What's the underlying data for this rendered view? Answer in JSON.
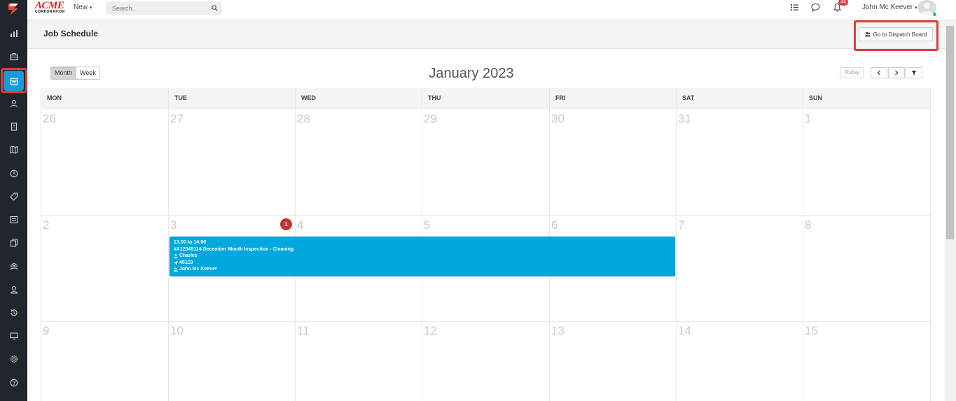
{
  "brand": {
    "name": "ACME",
    "tagline": "CORPORATION"
  },
  "topbar": {
    "new_label": "New",
    "search_placeholder": "Search..",
    "notification_count": "31",
    "user_name": "John Mc Keever"
  },
  "sidebar": {
    "items": [
      {
        "icon": "reports-icon"
      },
      {
        "icon": "briefcase-icon"
      },
      {
        "icon": "calendar-icon",
        "active": true
      },
      {
        "icon": "users-icon"
      },
      {
        "icon": "building-icon"
      },
      {
        "icon": "map-icon"
      },
      {
        "icon": "clock-icon"
      },
      {
        "icon": "tag-icon"
      },
      {
        "icon": "list-icon"
      },
      {
        "icon": "documents-icon"
      },
      {
        "icon": "team-icon"
      },
      {
        "icon": "person-icon"
      },
      {
        "icon": "history-icon"
      },
      {
        "icon": "monitor-icon"
      },
      {
        "icon": "settings-icon"
      },
      {
        "icon": "help-icon"
      }
    ]
  },
  "page": {
    "title": "Job Schedule",
    "dispatch_button": "Go to Dispatch Board"
  },
  "calendar": {
    "view_month": "Month",
    "view_week": "Week",
    "title": "January 2023",
    "today_label": "Today",
    "weekdays": [
      "MON",
      "TUE",
      "WED",
      "THU",
      "FRI",
      "SAT",
      "SUN"
    ],
    "weeks": [
      [
        "26",
        "27",
        "28",
        "29",
        "30",
        "31",
        "1"
      ],
      [
        "2",
        "3",
        "4",
        "5",
        "6",
        "7",
        "8"
      ],
      [
        "9",
        "10",
        "11",
        "12",
        "13",
        "14",
        "15"
      ]
    ],
    "event_count": "1",
    "event": {
      "time": "13:00 to 14:00",
      "title": "#A12345114 December Month Inspection - Cleaning",
      "customer": "Charles",
      "location": "45123",
      "assignee": "John Mc Keever"
    }
  },
  "colors": {
    "sidebar_bg": "#20262b",
    "active": "#1a9ad6",
    "highlight": "#e03b3b",
    "event_bg": "#00a8de"
  }
}
